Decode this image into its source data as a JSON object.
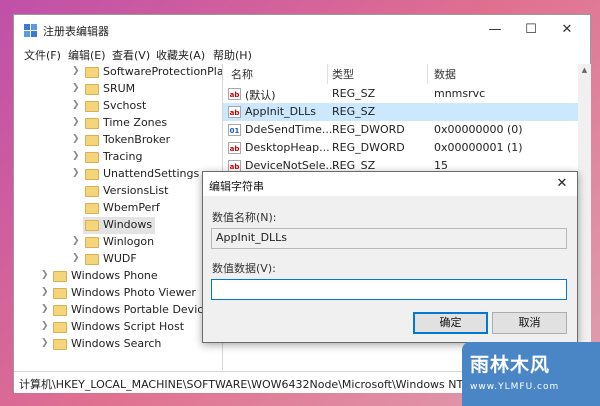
{
  "window": {
    "title": "注册表编辑器",
    "controls": [
      "minimize-icon",
      "maximize-icon",
      "close-icon"
    ]
  },
  "menu": [
    "文件(F)",
    "编辑(E)",
    "查看(V)",
    "收藏夹(A)",
    "帮助(H)"
  ],
  "tree": {
    "items": [
      {
        "label": "SoftwareProtectionPla",
        "level": 2,
        "expandable": true
      },
      {
        "label": "SRUM",
        "level": 2,
        "expandable": true
      },
      {
        "label": "Svchost",
        "level": 2,
        "expandable": true
      },
      {
        "label": "Time Zones",
        "level": 2,
        "expandable": true
      },
      {
        "label": "TokenBroker",
        "level": 2,
        "expandable": true
      },
      {
        "label": "Tracing",
        "level": 2,
        "expandable": true
      },
      {
        "label": "UnattendSettings",
        "level": 2,
        "expandable": true
      },
      {
        "label": "VersionsList",
        "level": 2,
        "expandable": false
      },
      {
        "label": "WbemPerf",
        "level": 2,
        "expandable": false
      },
      {
        "label": "Windows",
        "level": 2,
        "expandable": false,
        "selected": true
      },
      {
        "label": "Winlogon",
        "level": 2,
        "expandable": true
      },
      {
        "label": "WUDF",
        "level": 2,
        "expandable": true
      },
      {
        "label": "Windows Phone",
        "level": 1,
        "expandable": true
      },
      {
        "label": "Windows Photo Viewer",
        "level": 1,
        "expandable": true
      },
      {
        "label": "Windows Portable Devices",
        "level": 1,
        "expandable": true
      },
      {
        "label": "Windows Script Host",
        "level": 1,
        "expandable": true
      },
      {
        "label": "Windows Search",
        "level": 1,
        "expandable": true
      }
    ]
  },
  "list": {
    "columns": [
      "名称",
      "类型",
      "数据"
    ],
    "rows": [
      {
        "icon": "ab",
        "name": "(默认)",
        "type": "REG_SZ",
        "data": "mnmsrvc"
      },
      {
        "icon": "ab",
        "name": "AppInit_DLLs",
        "type": "REG_SZ",
        "data": "",
        "selected": true
      },
      {
        "icon": "dword",
        "name": "DdeSendTime...",
        "type": "REG_DWORD",
        "data": "0x00000000 (0)"
      },
      {
        "icon": "ab",
        "name": "DesktopHeap...",
        "type": "REG_DWORD",
        "data": "0x00000001 (1)"
      },
      {
        "icon": "ab",
        "name": "DeviceNotSele...",
        "type": "REG_SZ",
        "data": "15"
      }
    ]
  },
  "status": {
    "path": "计算机\\HKEY_LOCAL_MACHINE\\SOFTWARE\\WOW6432Node\\Microsoft\\Windows NT\\Curre"
  },
  "dialog": {
    "title": "编辑字符串",
    "name_label": "数值名称(N):",
    "name_value": "AppInit_DLLs",
    "data_label": "数值数据(V):",
    "data_value": "",
    "ok_label": "确定",
    "cancel_label": "取消"
  },
  "watermark": {
    "text": "雨林木风",
    "url": "www.YLMFU.com"
  },
  "colors": {
    "selection": "#cce8ff",
    "accent": "#0078d7",
    "folder": "#f5d57b"
  }
}
